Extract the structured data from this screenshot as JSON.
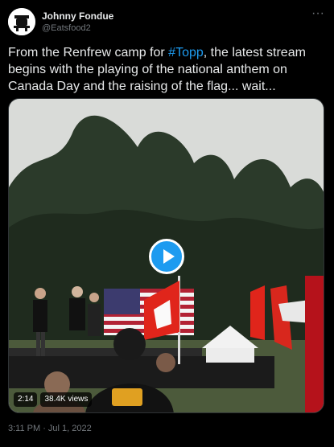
{
  "author": {
    "display_name": "Johnny Fondue",
    "handle": "@Eatsfood2"
  },
  "tweet": {
    "text_before": "From the Renfrew camp for ",
    "hashtag": "#Topp",
    "text_after": ", the latest stream begins with the playing of the national anthem on Canada Day and the raising of the flag... wait..."
  },
  "media": {
    "duration": "2:14",
    "views": "38.4K views",
    "play_icon": "play-icon"
  },
  "meta": {
    "timestamp": "3:11 PM · Jul 1, 2022"
  },
  "icons": {
    "more": "more-icon"
  },
  "colors": {
    "accent": "#1d9bf0",
    "background": "#000000",
    "secondary_text": "#71767b"
  }
}
